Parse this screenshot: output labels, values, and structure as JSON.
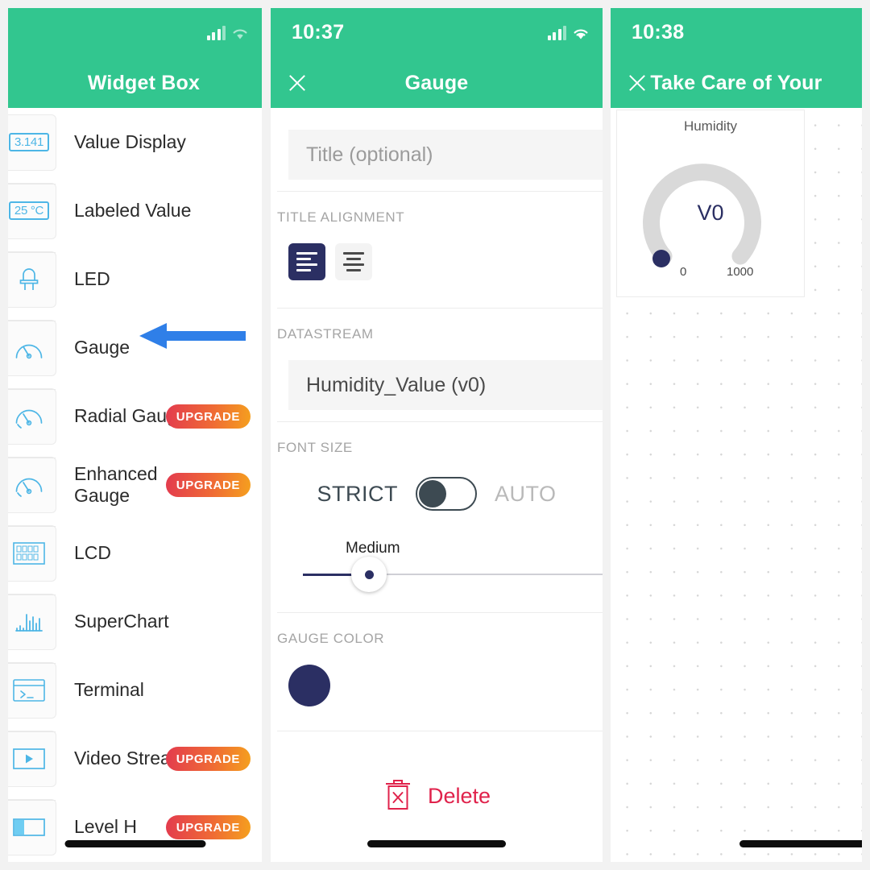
{
  "theme": {
    "header_green": "#32c68f",
    "accent_navy": "#2b2f63",
    "icon_blue": "#4db6e6",
    "delete_red": "#e0224b",
    "arrow_blue": "#2f7fe8",
    "badge_gradient_from": "#e33b4e",
    "badge_gradient_to": "#f5a01e"
  },
  "panel_left": {
    "status": {
      "time": "",
      "signal_icon": "signal-bars-icon",
      "wifi_icon": "wifi-icon"
    },
    "navbar": {
      "title": "Widget Box"
    },
    "items": [
      {
        "label": "Value Display",
        "icon": "value-display-icon",
        "icon_text": "3.141",
        "badge": ""
      },
      {
        "label": "Labeled Value",
        "icon": "labeled-value-icon",
        "icon_text": "25 °C",
        "badge": ""
      },
      {
        "label": "LED",
        "icon": "led-icon",
        "icon_text": "",
        "badge": ""
      },
      {
        "label": "Gauge",
        "icon": "gauge-icon",
        "icon_text": "",
        "badge": ""
      },
      {
        "label": "Radial Gauge",
        "icon": "radial-gauge-icon",
        "icon_text": "",
        "badge": "UPGRADE"
      },
      {
        "label": "Enhanced Gauge",
        "icon": "enhanced-gauge-icon",
        "icon_text": "",
        "badge": "UPGRADE"
      },
      {
        "label": "LCD",
        "icon": "lcd-icon",
        "icon_text": "",
        "badge": ""
      },
      {
        "label": "SuperChart",
        "icon": "superchart-icon",
        "icon_text": "",
        "badge": ""
      },
      {
        "label": "Terminal",
        "icon": "terminal-icon",
        "icon_text": "",
        "badge": ""
      },
      {
        "label": "Video Stream",
        "icon": "video-stream-icon",
        "icon_text": "",
        "badge": "UPGRADE"
      },
      {
        "label": "Level H",
        "icon": "level-h-icon",
        "icon_text": "",
        "badge": "UPGRADE"
      }
    ],
    "annotation": {
      "arrow": "left-pointing-arrow",
      "points_at": "Gauge"
    }
  },
  "panel_mid": {
    "status": {
      "time": "10:37",
      "signal_icon": "signal-bars-icon",
      "wifi_icon": "wifi-icon"
    },
    "navbar": {
      "title": "Gauge",
      "close_icon": "close-icon"
    },
    "title_field": {
      "placeholder": "Title (optional)",
      "value": ""
    },
    "title_alignment": {
      "label": "TITLE ALIGNMENT",
      "options": [
        "align-left",
        "align-center"
      ],
      "selected": "align-left"
    },
    "datastream": {
      "label": "DATASTREAM",
      "value": "Humidity_Value (v0)"
    },
    "font_size": {
      "label": "FONT SIZE",
      "left_option": "STRICT",
      "right_option": "AUTO",
      "toggle_state": "STRICT",
      "slider_value": "Medium"
    },
    "gauge_color": {
      "label": "GAUGE COLOR",
      "swatch": "#2b2f63"
    },
    "delete": {
      "label": "Delete",
      "icon": "trash-x-icon"
    }
  },
  "panel_right": {
    "status": {
      "time": "10:38",
      "signal_icon": "signal-bars-icon",
      "wifi_icon": "wifi-icon"
    },
    "navbar": {
      "title": "Take Care of Your",
      "close_icon": "close-icon"
    },
    "gauge_widget": {
      "title": "Humidity",
      "value_label": "V0",
      "min": "0",
      "max": "1000",
      "arc_color": "#d9d9d9",
      "knob_color": "#2b2f63"
    }
  }
}
